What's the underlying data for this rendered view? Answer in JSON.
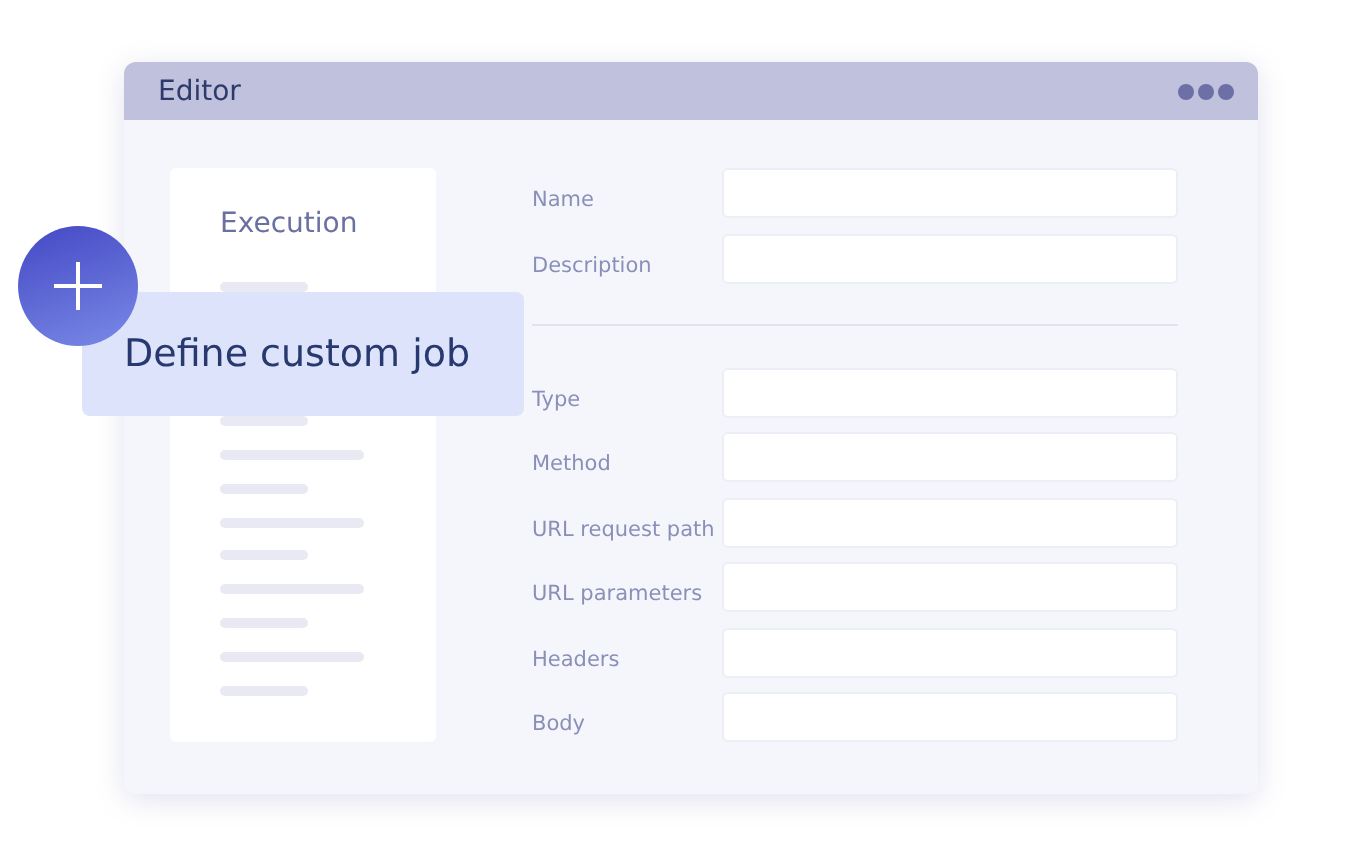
{
  "window": {
    "title": "Editor"
  },
  "sidebar": {
    "heading": "Execution"
  },
  "form": {
    "sections": [
      {
        "fields": [
          {
            "label": "Name"
          },
          {
            "label": "Description"
          }
        ]
      },
      {
        "fields": [
          {
            "label": "Type"
          },
          {
            "label": "Method"
          },
          {
            "label": "URL request path"
          },
          {
            "label": "URL parameters"
          },
          {
            "label": "Headers"
          },
          {
            "label": "Body"
          }
        ]
      }
    ]
  },
  "callout": {
    "label": "Define custom job"
  }
}
